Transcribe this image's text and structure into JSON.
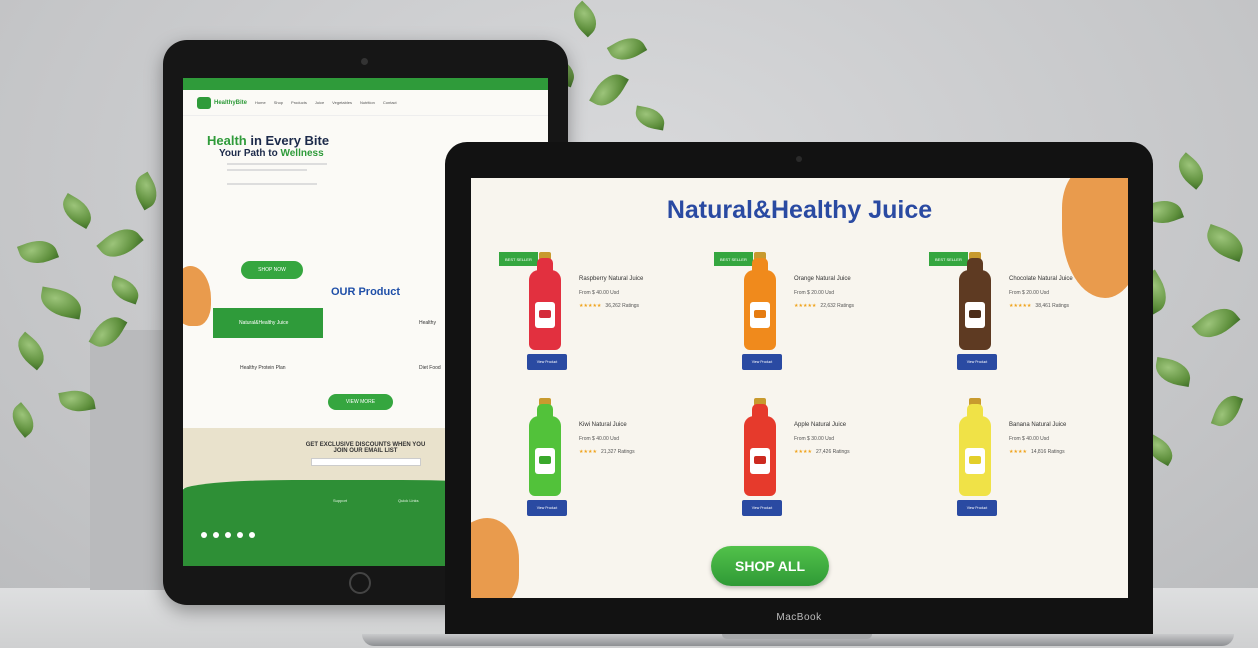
{
  "tablet": {
    "nav_logo": "HealthyBite",
    "nav_items": [
      "Home",
      "Shop",
      "Products",
      "Juice",
      "Vegetables",
      "Nutrition",
      "Contact"
    ],
    "hero_line1_highlight": "Health",
    "hero_line1_rest": " in Every Bite",
    "hero_line2_prefix": "Your Path to ",
    "hero_line2_highlight": "Wellness",
    "hero_button": "SHOP NOW",
    "section_title": "OUR Product",
    "product_1": "Natural&Healthy Juice",
    "product_2": "Healthy Protein Plan",
    "product_3": "Healthy",
    "product_4": "Diet Food",
    "button_2": "VIEW MORE",
    "newsletter_line1": "GET EXCLUSIVE DISCOUNTS WHEN YOU",
    "newsletter_line2": "JOIN OUR EMAIL LIST",
    "footer_col1": "Support",
    "footer_col2": "Quick Links"
  },
  "laptop": {
    "brand": "MacBook",
    "title": "Natural&Healthy Juice",
    "badge": "BEST SELLER",
    "view_label": "View Product",
    "shop_all": "SHOP ALL",
    "products": [
      {
        "name": "Raspberry Natural Juice",
        "price": "From $ 40.00 Usd",
        "stars": "★★★★★",
        "ratings": "36,262 Ratings",
        "color": "#e2303f",
        "label": "#d42b3a",
        "badge": true
      },
      {
        "name": "Orange Natural Juice",
        "price": "From $ 20.00 Usd",
        "stars": "★★★★★",
        "ratings": "22,632 Ratings",
        "color": "#f08a1c",
        "label": "#e57b10",
        "badge": true
      },
      {
        "name": "Chocolate Natural Juice",
        "price": "From $ 20.00 Usd",
        "stars": "★★★★★",
        "ratings": "38,461 Ratings",
        "color": "#5e3a22",
        "label": "#4b2c18",
        "badge": true
      },
      {
        "name": "Kiwi Natural Juice",
        "price": "From $ 40.00 Usd",
        "stars": "★★★★",
        "ratings": "21,327 Ratings",
        "color": "#52c23a",
        "label": "#3aa82c",
        "badge": false
      },
      {
        "name": "Apple Natural Juice",
        "price": "From $ 30.00 Usd",
        "stars": "★★★★",
        "ratings": "27,426 Ratings",
        "color": "#e63a2c",
        "label": "#cc2a20",
        "badge": false
      },
      {
        "name": "Banana Natural Juice",
        "price": "From $ 40.00 Usd",
        "stars": "★★★★",
        "ratings": "14,816 Ratings",
        "color": "#f0e247",
        "label": "#e3cf2a",
        "badge": false
      }
    ]
  }
}
